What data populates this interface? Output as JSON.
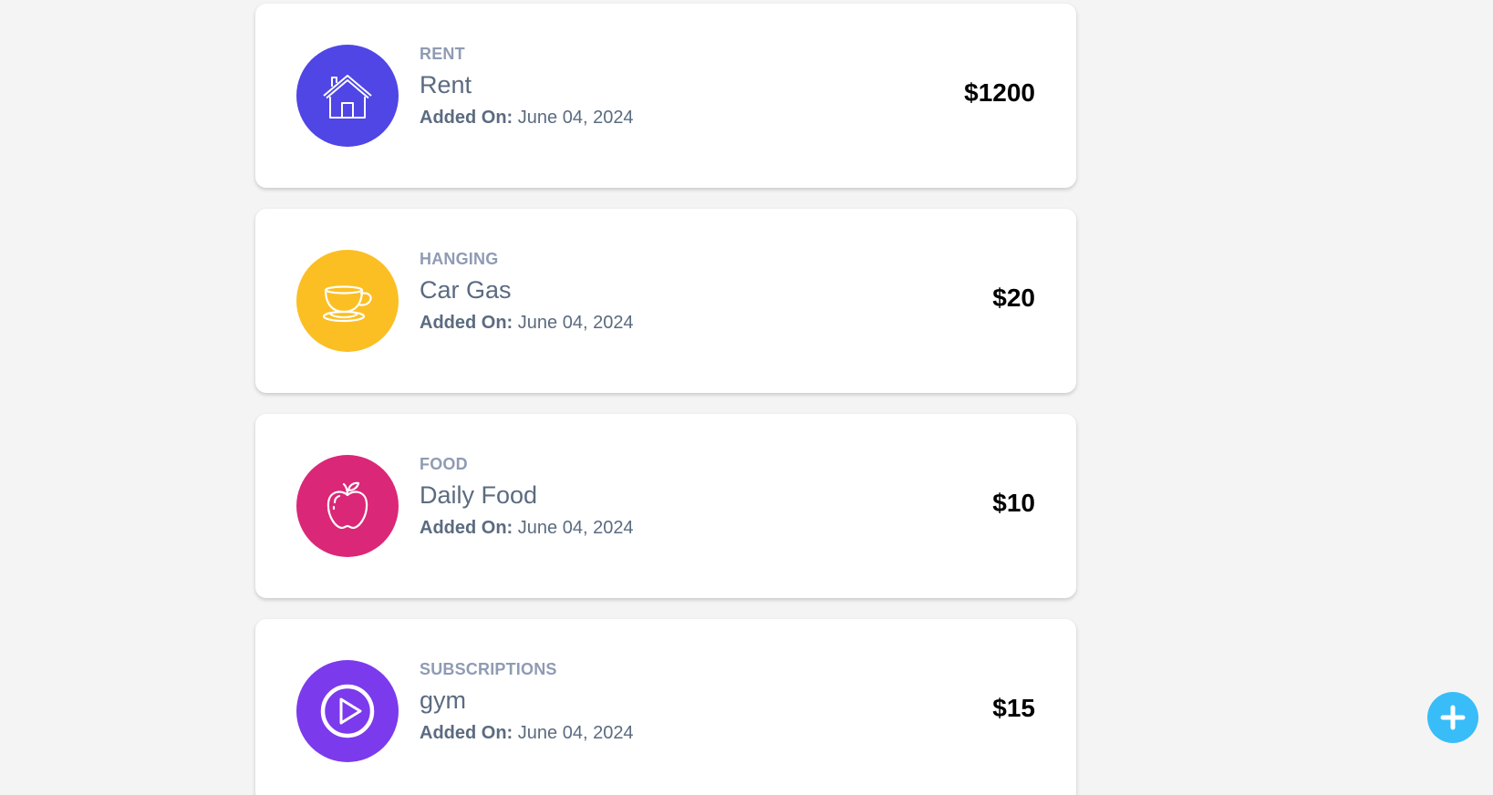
{
  "expenses": [
    {
      "category": "RENT",
      "name": "Rent",
      "added_label": "Added On:",
      "date": "June 04, 2024",
      "amount": "$1200",
      "icon": "house-icon",
      "color": "#4f46e5"
    },
    {
      "category": "HANGING",
      "name": "Car Gas",
      "added_label": "Added On:",
      "date": "June 04, 2024",
      "amount": "$20",
      "icon": "coffee-cup-icon",
      "color": "#fbbf24"
    },
    {
      "category": "FOOD",
      "name": "Daily Food",
      "added_label": "Added On:",
      "date": "June 04, 2024",
      "amount": "$10",
      "icon": "apple-icon",
      "color": "#db2777"
    },
    {
      "category": "SUBSCRIPTIONS",
      "name": "gym",
      "added_label": "Added On:",
      "date": "June 04, 2024",
      "amount": "$15",
      "icon": "play-icon",
      "color": "#7c3aed"
    }
  ],
  "fab": {
    "icon": "plus-icon",
    "color": "#38bdf8"
  }
}
